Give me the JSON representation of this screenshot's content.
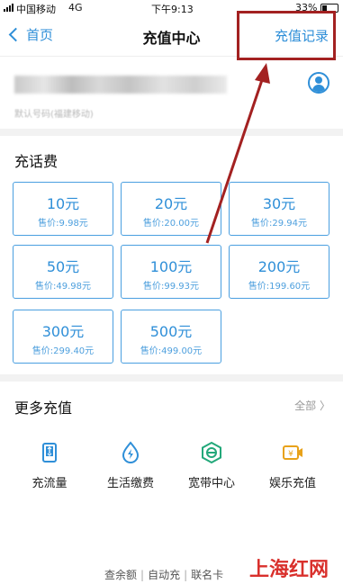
{
  "status_bar": {
    "carrier": "中国移动",
    "network": "4G",
    "time": "下午9:13",
    "battery": "33%"
  },
  "nav": {
    "back_label": "首页",
    "title": "充值中心",
    "right_label": "充值记录"
  },
  "account": {
    "subline": "默认号码(福建移动)"
  },
  "recharge": {
    "title": "充话费",
    "cards": [
      {
        "amount": "10元",
        "price": "售价:9.98元"
      },
      {
        "amount": "20元",
        "price": "售价:20.00元"
      },
      {
        "amount": "30元",
        "price": "售价:29.94元"
      },
      {
        "amount": "50元",
        "price": "售价:49.98元"
      },
      {
        "amount": "100元",
        "price": "售价:99.93元"
      },
      {
        "amount": "200元",
        "price": "售价:199.60元"
      },
      {
        "amount": "300元",
        "price": "售价:299.40元"
      },
      {
        "amount": "500元",
        "price": "售价:499.00元"
      }
    ]
  },
  "more": {
    "title": "更多充值",
    "all_label": "全部 〉",
    "items": [
      {
        "label": "充流量",
        "icon": "data-icon"
      },
      {
        "label": "生活缴费",
        "icon": "lightning-icon"
      },
      {
        "label": "宽带中心",
        "icon": "broadband-icon"
      },
      {
        "label": "娱乐充值",
        "icon": "entertainment-icon"
      }
    ]
  },
  "footer": {
    "links": [
      "查余额",
      "自动充",
      "联名卡"
    ]
  },
  "watermark": "上海红网",
  "colors": {
    "accent": "#2f8fd8",
    "annotation": "#a32121",
    "watermark": "#d9302c"
  }
}
